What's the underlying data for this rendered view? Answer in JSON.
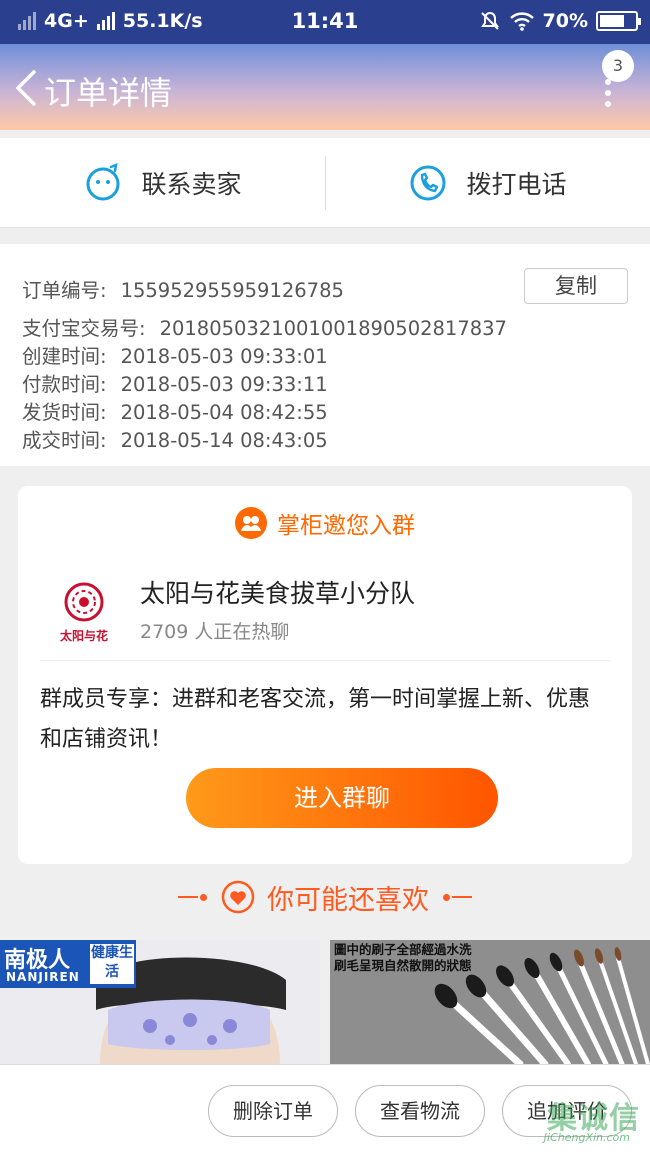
{
  "status_bar": {
    "network": "4G+",
    "speed": "55.1K/s",
    "time": "11:41",
    "battery": "70%",
    "battery_level": 0.7
  },
  "header": {
    "title": "订单详情",
    "notification_count": "3",
    "gradient_colors": [
      "#6f8fd8",
      "#ffc9a8"
    ]
  },
  "contact": {
    "seller_label": "联系卖家",
    "call_label": "拨打电话",
    "icon_color": "#1a9fe0"
  },
  "order_info": {
    "copy_label": "复制",
    "rows": [
      {
        "label": "订单编号:",
        "value": "155952955959126785"
      },
      {
        "label": "支付宝交易号:",
        "value": "2018050321001001890502817837"
      },
      {
        "label": "创建时间:",
        "value": "2018-05-03 09:33:01"
      },
      {
        "label": "付款时间:",
        "value": "2018-05-03 09:33:11"
      },
      {
        "label": "发货时间:",
        "value": "2018-05-04 08:42:55"
      },
      {
        "label": "成交时间:",
        "value": "2018-05-14 08:43:05"
      }
    ]
  },
  "group_card": {
    "heading": "掌柜邀您入群",
    "shop_name": "太阳与花美食拔草小分队",
    "members_online": "2709 人正在热聊",
    "logo_text": "太阳与花",
    "description": "群成员专享：进群和老客交流，第一时间掌握上新、优惠和店铺资讯！",
    "join_label": "进入群聊",
    "accent_color": "#ff6a00"
  },
  "recommend": {
    "title": "你可能还喜欢"
  },
  "products": [
    {
      "brand_cn": "南极人",
      "brand_en": "NANJIREN",
      "tag": "健康生活"
    },
    {
      "caption_line1": "圖中的刷子全部經過水洗",
      "caption_line2": "刷毛呈現自然散開的狀態"
    }
  ],
  "bottom_bar": {
    "buttons": [
      "删除订单",
      "查看物流",
      "追加评价"
    ]
  },
  "watermark": {
    "cn": "集诚信",
    "en": "JiChengXin.com"
  }
}
